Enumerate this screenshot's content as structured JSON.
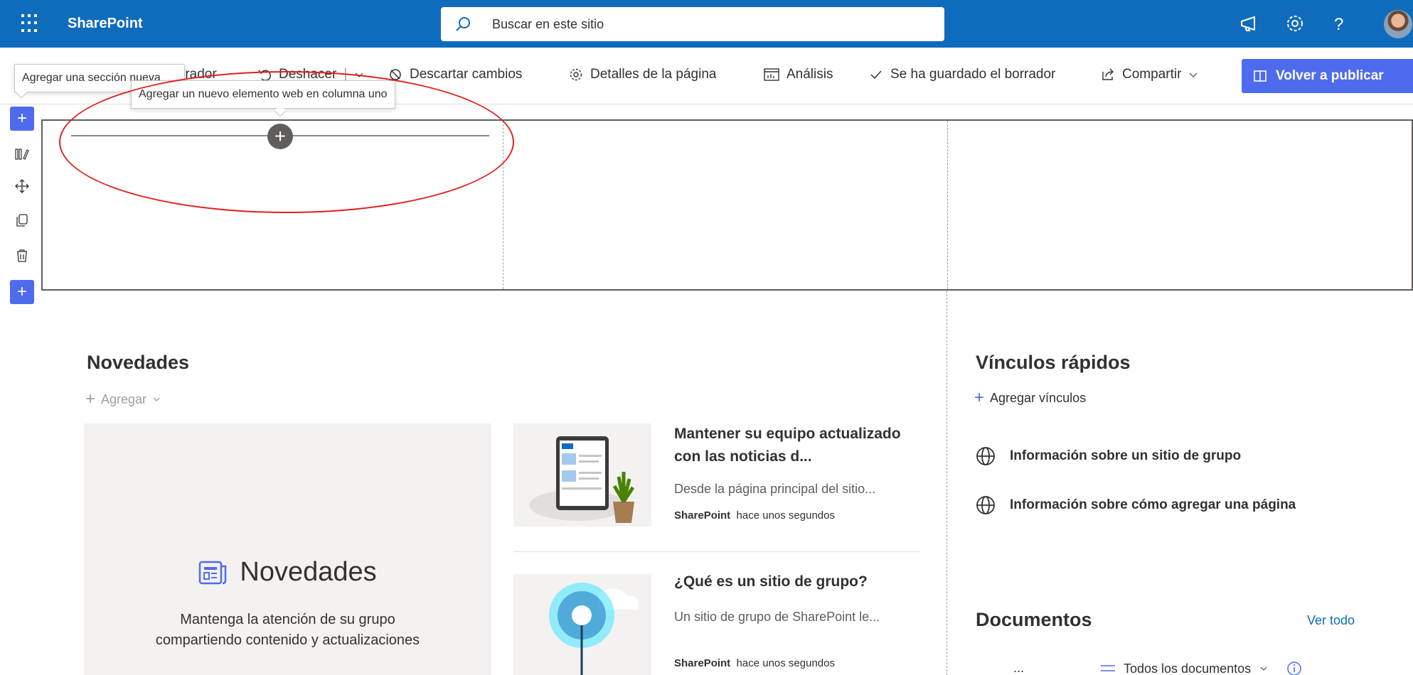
{
  "suitebar": {
    "brand": "SharePoint",
    "search_placeholder": "Buscar en este sitio"
  },
  "commandbar": {
    "draft_label": "rrador",
    "undo_label": "Deshacer",
    "discard_label": "Descartar cambios",
    "page_details_label": "Detalles de la página",
    "analytics_label": "Análisis",
    "saved_status": "Se ha guardado el borrador",
    "share_label": "Compartir",
    "republish_label": "Volver a publicar"
  },
  "tooltips": {
    "add_section": "Agregar una sección nueva",
    "add_webpart": "Agregar un nuevo elemento web en columna uno"
  },
  "news": {
    "heading": "Novedades",
    "add_label": "Agregar",
    "empty_title": "Novedades",
    "empty_desc": "Mantenga la atención de su grupo compartiendo contenido y actualizaciones",
    "items": [
      {
        "title": "Mantener su equipo actualizado con las noticias d...",
        "desc": "Desde la página principal del sitio...",
        "source": "SharePoint",
        "time": "hace unos segundos"
      },
      {
        "title": "¿Qué es un sitio de grupo?",
        "desc": "Un sitio de grupo de SharePoint le...",
        "source": "SharePoint",
        "time": "hace unos segundos"
      }
    ]
  },
  "quicklinks": {
    "heading": "Vínculos rápidos",
    "add_label": "Agregar vínculos",
    "items": [
      {
        "label": "Información sobre un sitio de grupo"
      },
      {
        "label": "Información sobre cómo agregar una página"
      }
    ]
  },
  "documents": {
    "heading": "Documentos",
    "see_all": "Ver todo",
    "more": "...",
    "view_label": "Todos los documentos"
  },
  "colors": {
    "suitebar": "#0f6cbd",
    "accent": "#4f6bed",
    "annotation": "#e02020"
  }
}
